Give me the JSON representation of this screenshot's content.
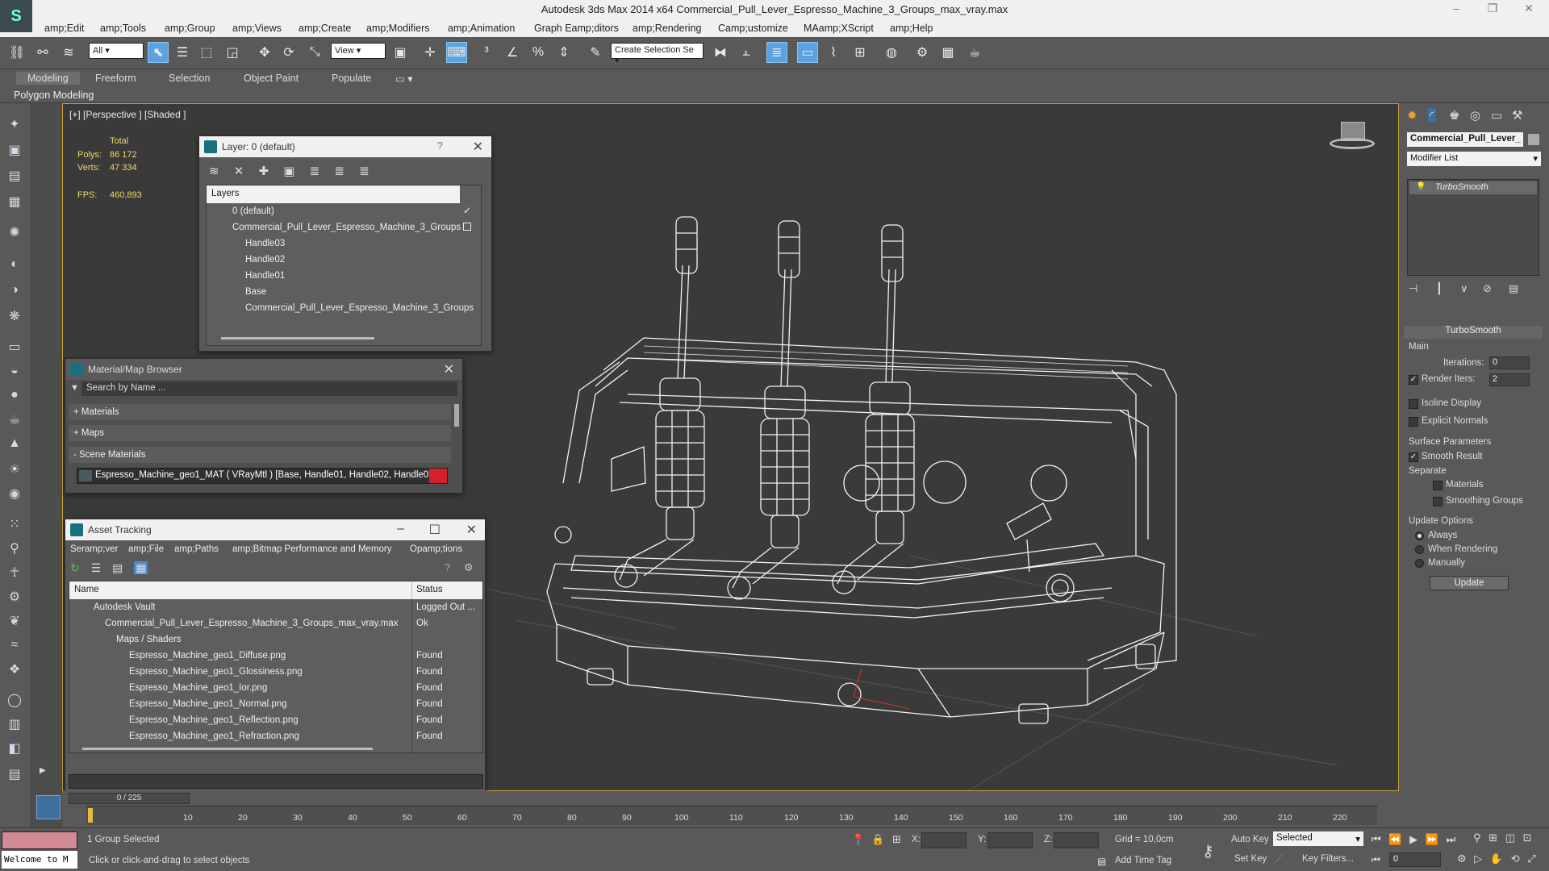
{
  "window": {
    "title": "Autodesk 3ds Max  2014 x64     Commercial_Pull_Lever_Espresso_Machine_3_Groups_max_vray.max"
  },
  "menu": [
    "amp;Edit",
    "amp;Tools",
    "amp;Group",
    "amp;Views",
    "amp;Create",
    "amp;Modifiers",
    "amp;Animation",
    "Graph Eamp;ditors",
    "amp;Rendering",
    "Camp;ustomize",
    "MAamp;XScript",
    "amp;Help"
  ],
  "toolbar": {
    "filter_value": "All",
    "refcoord_value": "View",
    "selection_set_placeholder": "Create Selection Se"
  },
  "ribbon": {
    "tabs": [
      "Modeling",
      "Freeform",
      "Selection",
      "Object Paint",
      "Populate"
    ],
    "subtitle": "Polygon Modeling"
  },
  "viewport": {
    "label": "[+] [Perspective ] [Shaded ]",
    "stats": {
      "total_label": "Total",
      "polys_label": "Polys:",
      "polys_value": "86 172",
      "verts_label": "Verts:",
      "verts_value": "47 334",
      "fps_label": "FPS:",
      "fps_value": "460,893"
    }
  },
  "layer_window": {
    "title": "Layer: 0 (default)",
    "header": "Layers",
    "rows": [
      "0 (default)",
      "Commercial_Pull_Lever_Espresso_Machine_3_Groups",
      "Handle03",
      "Handle02",
      "Handle01",
      "Base",
      "Commercial_Pull_Lever_Espresso_Machine_3_Groups"
    ]
  },
  "material_browser": {
    "title": "Material/Map Browser",
    "search_placeholder": "Search by Name ...",
    "sections": [
      "+ Materials",
      "+ Maps",
      "- Scene Materials"
    ],
    "scene_material": "Espresso_Machine_geo1_MAT  ( VRayMtl ) [Base, Handle01, Handle02, Handle03]"
  },
  "asset_tracking": {
    "title": "Asset Tracking",
    "menu": [
      "Seramp;ver",
      "amp;File",
      "amp;Paths",
      "amp;Bitmap Performance and Memory",
      "Opamp;tions"
    ],
    "columns": [
      "Name",
      "Status"
    ],
    "rows": [
      {
        "name": "Autodesk Vault",
        "status": "Logged Out ..."
      },
      {
        "name": "Commercial_Pull_Lever_Espresso_Machine_3_Groups_max_vray.max",
        "status": "Ok"
      },
      {
        "name": "Maps / Shaders",
        "status": ""
      },
      {
        "name": "Espresso_Machine_geo1_Diffuse.png",
        "status": "Found"
      },
      {
        "name": "Espresso_Machine_geo1_Glossiness.png",
        "status": "Found"
      },
      {
        "name": "Espresso_Machine_geo1_Ior.png",
        "status": "Found"
      },
      {
        "name": "Espresso_Machine_geo1_Normal.png",
        "status": "Found"
      },
      {
        "name": "Espresso_Machine_geo1_Reflection.png",
        "status": "Found"
      },
      {
        "name": "Espresso_Machine_geo1_Refraction.png",
        "status": "Found"
      }
    ]
  },
  "command_panel": {
    "object_name": "Commercial_Pull_Lever_",
    "modifier_list": "Modifier List",
    "stack_item": "TurboSmooth",
    "rollout_title": "TurboSmooth",
    "main_label": "Main",
    "iterations_label": "Iterations:",
    "iterations_value": "0",
    "render_iters_label": "Render Iters:",
    "render_iters_value": "2",
    "isoline_label": "Isoline Display",
    "explicit_normals_label": "Explicit Normals",
    "surface_params_label": "Surface Parameters",
    "smooth_result_label": "Smooth Result",
    "separate_label": "Separate",
    "materials_label": "Materials",
    "smoothing_groups_label": "Smoothing Groups",
    "update_options_label": "Update Options",
    "always_label": "Always",
    "when_rendering_label": "When Rendering",
    "manually_label": "Manually",
    "update_button": "Update"
  },
  "timeline": {
    "frame_counter": "0 / 225",
    "ticks": [
      "10",
      "20",
      "30",
      "40",
      "50",
      "60",
      "70",
      "80",
      "90",
      "100",
      "110",
      "120",
      "130",
      "140",
      "150",
      "160",
      "170",
      "180",
      "190",
      "200",
      "210",
      "220"
    ]
  },
  "status": {
    "welcome": "Welcome to M",
    "selection_info": "1 Group Selected",
    "prompt": "Click or click-and-drag to select objects",
    "x_label": "X:",
    "y_label": "Y:",
    "z_label": "Z:",
    "grid": "Grid = 10,0cm",
    "add_time_tag": "Add Time Tag",
    "auto_key": "Auto Key",
    "selected_value": "Selected",
    "set_key": "Set Key",
    "key_filters": "Key Filters...",
    "frame_value": "0"
  }
}
